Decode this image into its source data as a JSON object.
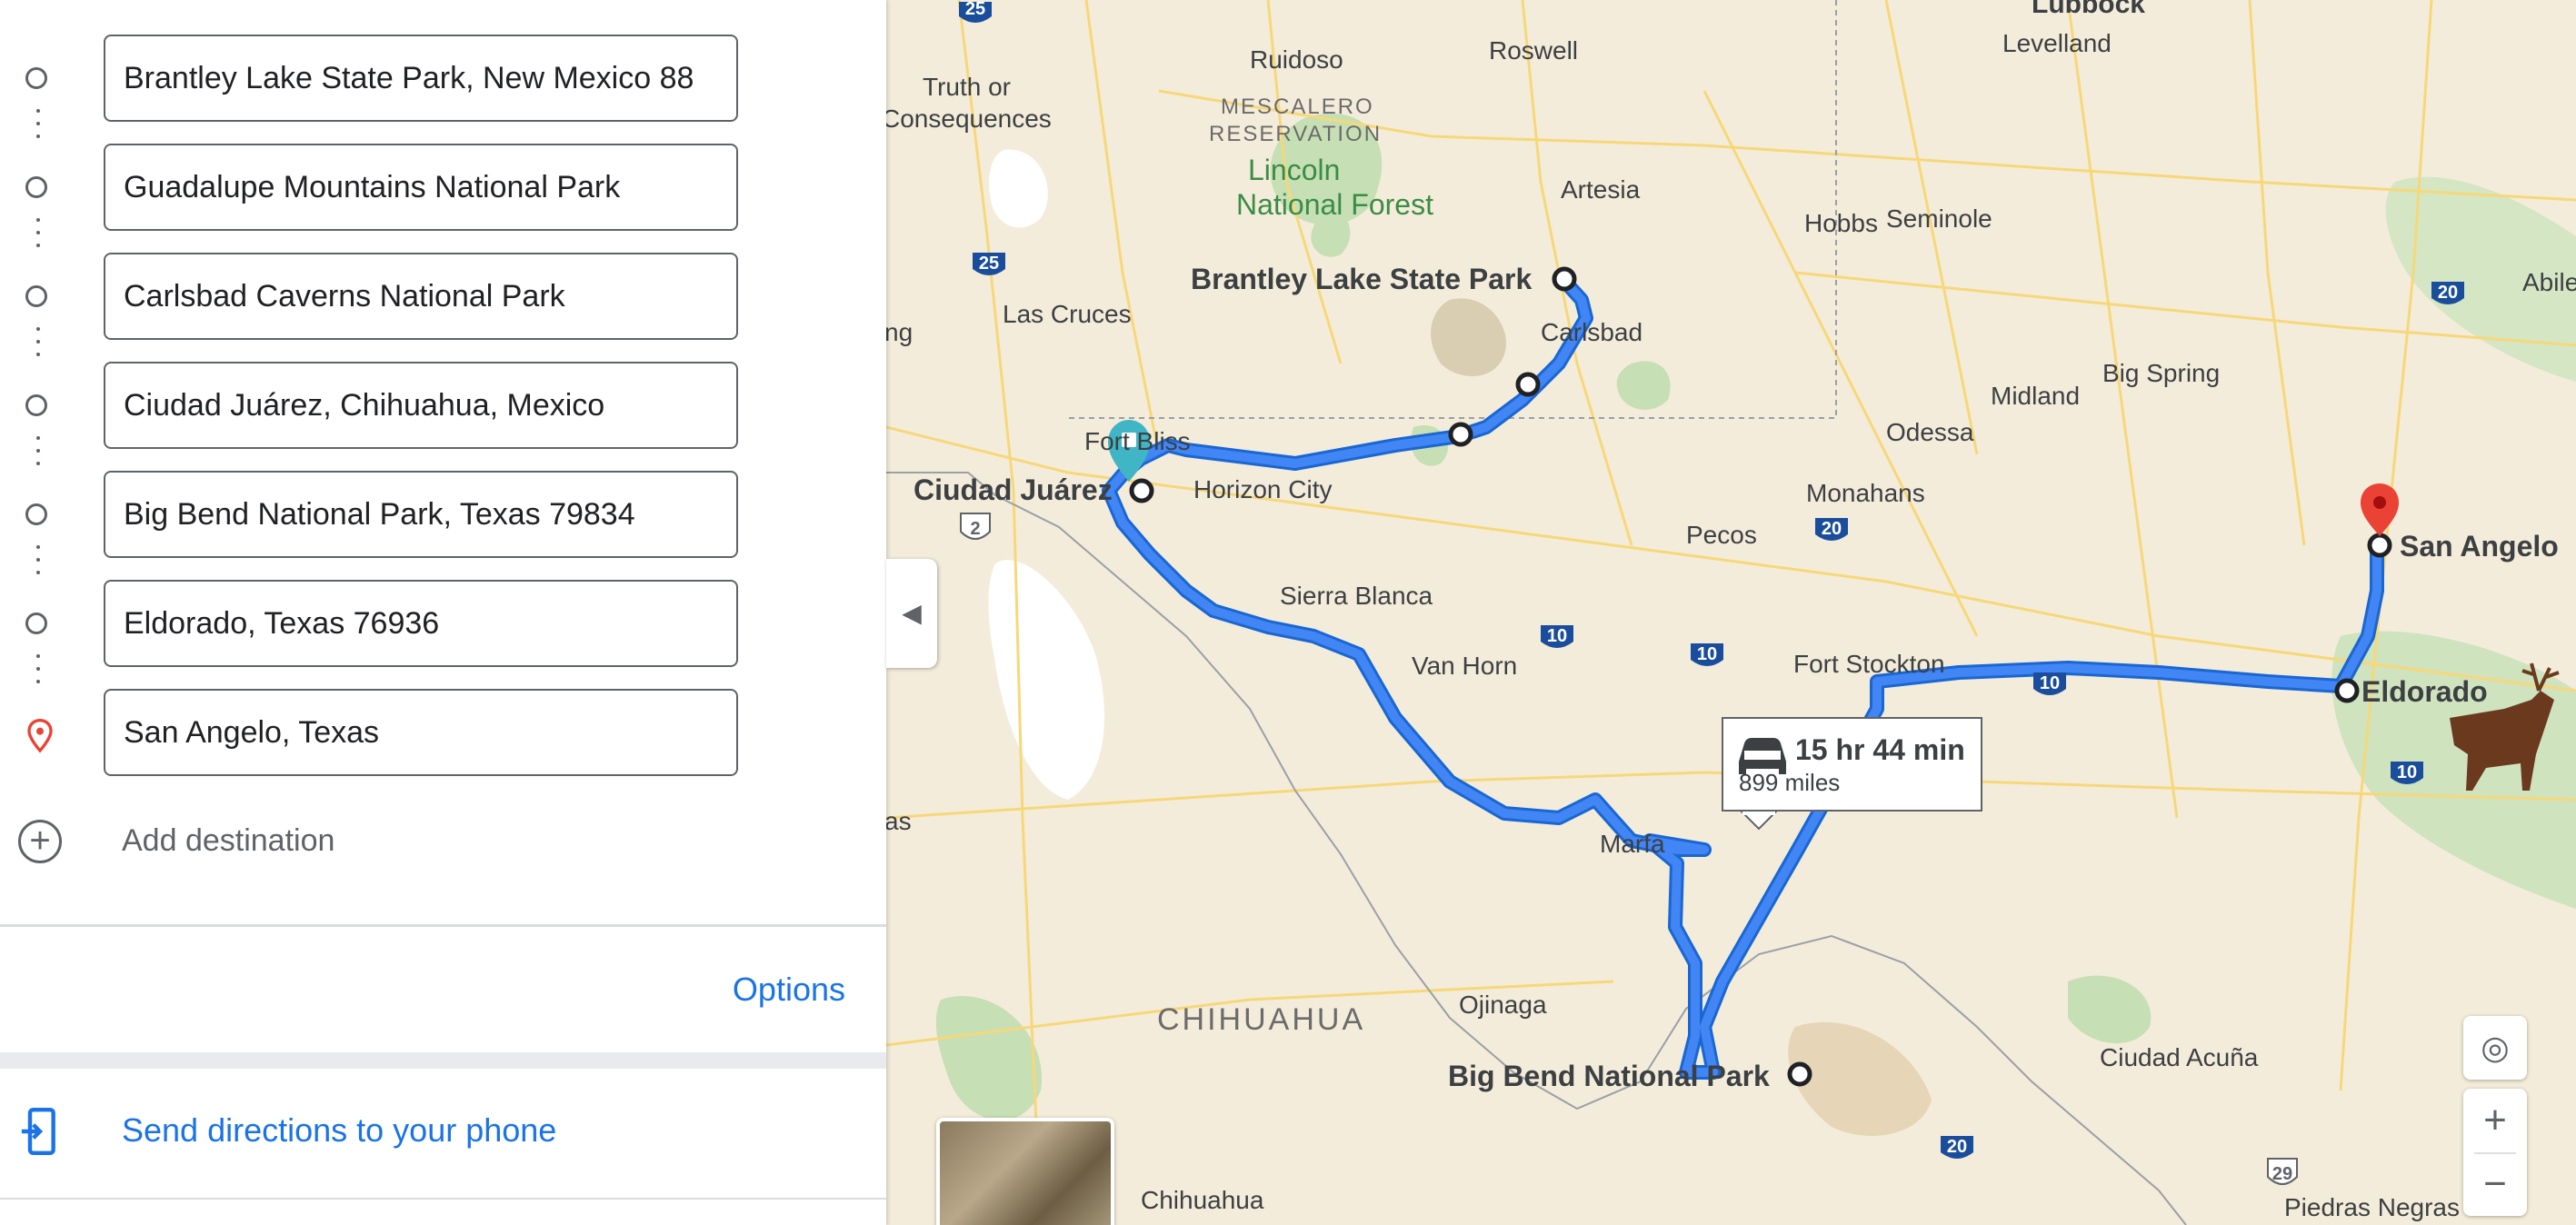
{
  "waypoints": [
    {
      "value": "Brantley Lake State Park, New Mexico 88",
      "marker": "circle"
    },
    {
      "value": "Guadalupe Mountains National Park",
      "marker": "circle"
    },
    {
      "value": "Carlsbad Caverns National Park",
      "marker": "circle"
    },
    {
      "value": "Ciudad Juárez, Chihuahua, Mexico",
      "marker": "circle"
    },
    {
      "value": "Big Bend National Park, Texas 79834",
      "marker": "circle"
    },
    {
      "value": "Eldorado, Texas 76936",
      "marker": "circle"
    },
    {
      "value": "San Angelo, Texas",
      "marker": "pin"
    }
  ],
  "add_destination": "Add destination",
  "options_label": "Options",
  "send_directions": "Send directions to your phone",
  "route_info": {
    "duration": "15 hr 44 min",
    "distance": "899 miles"
  },
  "map_labels": {
    "lubbock": "Lubbock",
    "ruidoso": "Ruidoso",
    "roswell": "Roswell",
    "levelland": "Levelland",
    "truth": "Truth or",
    "consequences": "Consequences",
    "mescalero1": "MESCALERO",
    "mescalero2": "RESERVATION",
    "lincoln1": "Lincoln",
    "lincoln2": "National Forest",
    "artesia": "Artesia",
    "hobbs": "Hobbs",
    "seminole": "Seminole",
    "brantley": "Brantley Lake State Park",
    "carlsbad": "Carlsbad",
    "las_cruces": "Las Cruces",
    "ng": "ng",
    "abilene": "Abilene",
    "big_spring": "Big Spring",
    "midland": "Midland",
    "odessa": "Odessa",
    "fort_bliss": "Fort Bliss",
    "ciudad_juarez": "Ciudad Juárez",
    "horizon_city": "Horizon City",
    "monahans": "Monahans",
    "pecos": "Pecos",
    "san_angelo": "San Angelo",
    "sierra_blanca": "Sierra Blanca",
    "van_horn": "Van Horn",
    "fort_stockton": "Fort Stockton",
    "eldorado": "Eldorado",
    "as": "as",
    "marfa": "Marfa",
    "chihuahua_state": "CHIHUAHUA",
    "ojinaga": "Ojinaga",
    "big_bend": "Big Bend National Park",
    "ciudad_acuna": "Ciudad Acuña",
    "piedras_negras": "Piedras Negras",
    "chihuahua_city": "Chihuahua"
  },
  "highway_shields": [
    "25",
    "25",
    "20",
    "20",
    "10",
    "10",
    "10",
    "10",
    "20",
    "2",
    "29"
  ],
  "colors": {
    "route": "#4285f4",
    "accent": "#1a73e8",
    "pin_red": "#ea4335",
    "pin_teal": "#3fb5c5"
  }
}
